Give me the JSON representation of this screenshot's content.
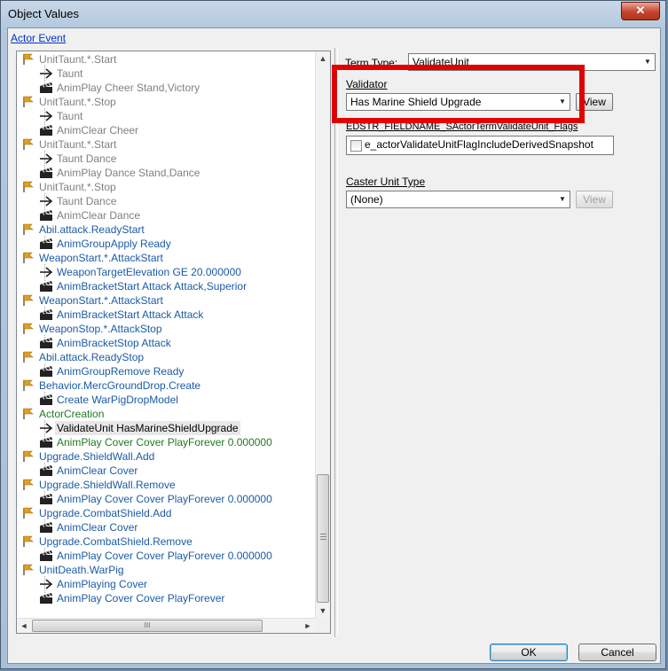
{
  "window": {
    "title": "Object Values",
    "close_glyph": "✕"
  },
  "link": "Actor Event",
  "tree": {
    "rows": [
      {
        "level": 0,
        "kind": "flag",
        "text": "UnitTaunt.*.Start",
        "color": "gray"
      },
      {
        "level": 1,
        "kind": "arrow",
        "text": "Taunt",
        "color": "gray"
      },
      {
        "level": 1,
        "kind": "clap",
        "text": "AnimPlay Cheer Stand,Victory",
        "color": "gray"
      },
      {
        "level": 0,
        "kind": "flag",
        "text": "UnitTaunt.*.Stop",
        "color": "gray"
      },
      {
        "level": 1,
        "kind": "arrow",
        "text": "Taunt",
        "color": "gray"
      },
      {
        "level": 1,
        "kind": "clap",
        "text": "AnimClear Cheer",
        "color": "gray"
      },
      {
        "level": 0,
        "kind": "flag",
        "text": "UnitTaunt.*.Start",
        "color": "gray"
      },
      {
        "level": 1,
        "kind": "arrow",
        "text": "Taunt Dance",
        "color": "gray"
      },
      {
        "level": 1,
        "kind": "clap",
        "text": "AnimPlay Dance Stand,Dance",
        "color": "gray"
      },
      {
        "level": 0,
        "kind": "flag",
        "text": "UnitTaunt.*.Stop",
        "color": "gray"
      },
      {
        "level": 1,
        "kind": "arrow",
        "text": "Taunt Dance",
        "color": "gray"
      },
      {
        "level": 1,
        "kind": "clap",
        "text": "AnimClear Dance",
        "color": "gray"
      },
      {
        "level": 0,
        "kind": "flag",
        "text": "Abil.attack.ReadyStart",
        "color": "blue"
      },
      {
        "level": 1,
        "kind": "clap",
        "text": "AnimGroupApply Ready",
        "color": "blue"
      },
      {
        "level": 0,
        "kind": "flag",
        "text": "WeaponStart.*.AttackStart",
        "color": "blue"
      },
      {
        "level": 1,
        "kind": "arrow",
        "text": "WeaponTargetElevation GE 20.000000",
        "color": "blue"
      },
      {
        "level": 1,
        "kind": "clap",
        "text": "AnimBracketStart Attack Attack,Superior",
        "color": "blue"
      },
      {
        "level": 0,
        "kind": "flag",
        "text": "WeaponStart.*.AttackStart",
        "color": "blue"
      },
      {
        "level": 1,
        "kind": "clap",
        "text": "AnimBracketStart Attack Attack",
        "color": "blue"
      },
      {
        "level": 0,
        "kind": "flag",
        "text": "WeaponStop.*.AttackStop",
        "color": "blue"
      },
      {
        "level": 1,
        "kind": "clap",
        "text": "AnimBracketStop Attack",
        "color": "blue"
      },
      {
        "level": 0,
        "kind": "flag",
        "text": "Abil.attack.ReadyStop",
        "color": "blue"
      },
      {
        "level": 1,
        "kind": "clap",
        "text": "AnimGroupRemove Ready",
        "color": "blue"
      },
      {
        "level": 0,
        "kind": "flag",
        "text": "Behavior.MercGroundDrop.Create",
        "color": "blue"
      },
      {
        "level": 1,
        "kind": "clap",
        "text": "Create WarPigDropModel",
        "color": "blue"
      },
      {
        "level": 0,
        "kind": "flag",
        "text": "ActorCreation",
        "color": "green"
      },
      {
        "level": 1,
        "kind": "arrow",
        "text": "ValidateUnit HasMarineShieldUpgrade",
        "color": "black",
        "selected": true
      },
      {
        "level": 1,
        "kind": "clap",
        "text": "AnimPlay Cover Cover PlayForever 0.000000",
        "color": "green"
      },
      {
        "level": 0,
        "kind": "flag",
        "text": "Upgrade.ShieldWall.Add",
        "color": "blue"
      },
      {
        "level": 1,
        "kind": "clap",
        "text": "AnimClear Cover",
        "color": "blue"
      },
      {
        "level": 0,
        "kind": "flag",
        "text": "Upgrade.ShieldWall.Remove",
        "color": "blue"
      },
      {
        "level": 1,
        "kind": "clap",
        "text": "AnimPlay Cover Cover PlayForever 0.000000",
        "color": "blue"
      },
      {
        "level": 0,
        "kind": "flag",
        "text": "Upgrade.CombatShield.Add",
        "color": "blue"
      },
      {
        "level": 1,
        "kind": "clap",
        "text": "AnimClear Cover",
        "color": "blue"
      },
      {
        "level": 0,
        "kind": "flag",
        "text": "Upgrade.CombatShield.Remove",
        "color": "blue"
      },
      {
        "level": 1,
        "kind": "clap",
        "text": "AnimPlay Cover Cover PlayForever 0.000000",
        "color": "blue"
      },
      {
        "level": 0,
        "kind": "flag",
        "text": "UnitDeath.WarPig",
        "color": "blue"
      },
      {
        "level": 1,
        "kind": "arrow",
        "text": "AnimPlaying Cover",
        "color": "blue"
      },
      {
        "level": 1,
        "kind": "clap",
        "text": "AnimPlay Cover Cover PlayForever",
        "color": "blue"
      }
    ]
  },
  "scroll": {
    "up": "▲",
    "down": "▼",
    "left": "◄",
    "right": "►",
    "hgrip": "III"
  },
  "form": {
    "term_type_label": "Term Type:",
    "term_type_value": "ValidateUnit",
    "validator_label": "Validator",
    "validator_value": "Has Marine Shield Upgrade",
    "validator_view": "View",
    "flags_label": "EDSTR_FIELDNAME_SActorTermValidateUnit_Flags",
    "flag_option": "e_actorValidateUnitFlagIncludeDerivedSnapshot",
    "caster_label": "Caster Unit Type",
    "caster_value": "(None)",
    "caster_view": "View",
    "dropdown_glyph": "▼"
  },
  "footer": {
    "ok": "OK",
    "cancel": "Cancel"
  },
  "colors": {
    "highlight": "#e00000",
    "tree_blue": "#1c5ba6",
    "tree_green": "#1f7a1f",
    "tree_gray": "#808080",
    "flag": "#e0a020"
  }
}
